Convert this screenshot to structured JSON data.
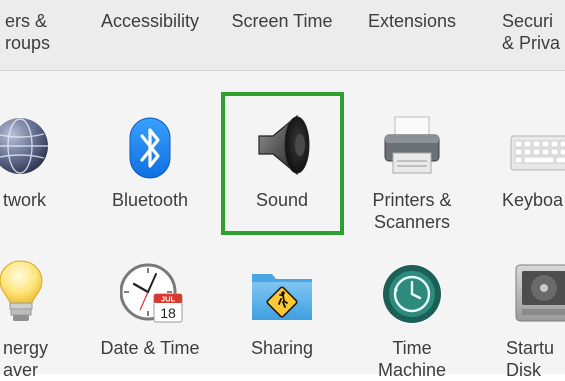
{
  "top_row": [
    {
      "id": "users-groups",
      "label": "ers &\nroups"
    },
    {
      "id": "accessibility",
      "label": "Accessibility"
    },
    {
      "id": "screen-time",
      "label": "Screen Time"
    },
    {
      "id": "extensions",
      "label": "Extensions"
    },
    {
      "id": "security-privacy",
      "label": "Securi\n& Priva"
    }
  ],
  "row2": [
    {
      "id": "network",
      "label": "twork"
    },
    {
      "id": "bluetooth",
      "label": "Bluetooth"
    },
    {
      "id": "sound",
      "label": "Sound",
      "highlighted": true
    },
    {
      "id": "printers-scanners",
      "label": "Printers &\nScanners"
    },
    {
      "id": "keyboard",
      "label": "Keyboa"
    }
  ],
  "row3": [
    {
      "id": "energy-saver",
      "label": "nergy\naver"
    },
    {
      "id": "date-time",
      "label": "Date & Time",
      "calendar_month": "JUL",
      "calendar_day": "18"
    },
    {
      "id": "sharing",
      "label": "Sharing"
    },
    {
      "id": "time-machine",
      "label": "Time\nMachine"
    },
    {
      "id": "startup-disk",
      "label": "Startu\nDisk"
    }
  ],
  "colors": {
    "highlight": "#2fa02f",
    "bluetooth": "#1e88ff",
    "sharing_folder": "#5bb2ea"
  }
}
